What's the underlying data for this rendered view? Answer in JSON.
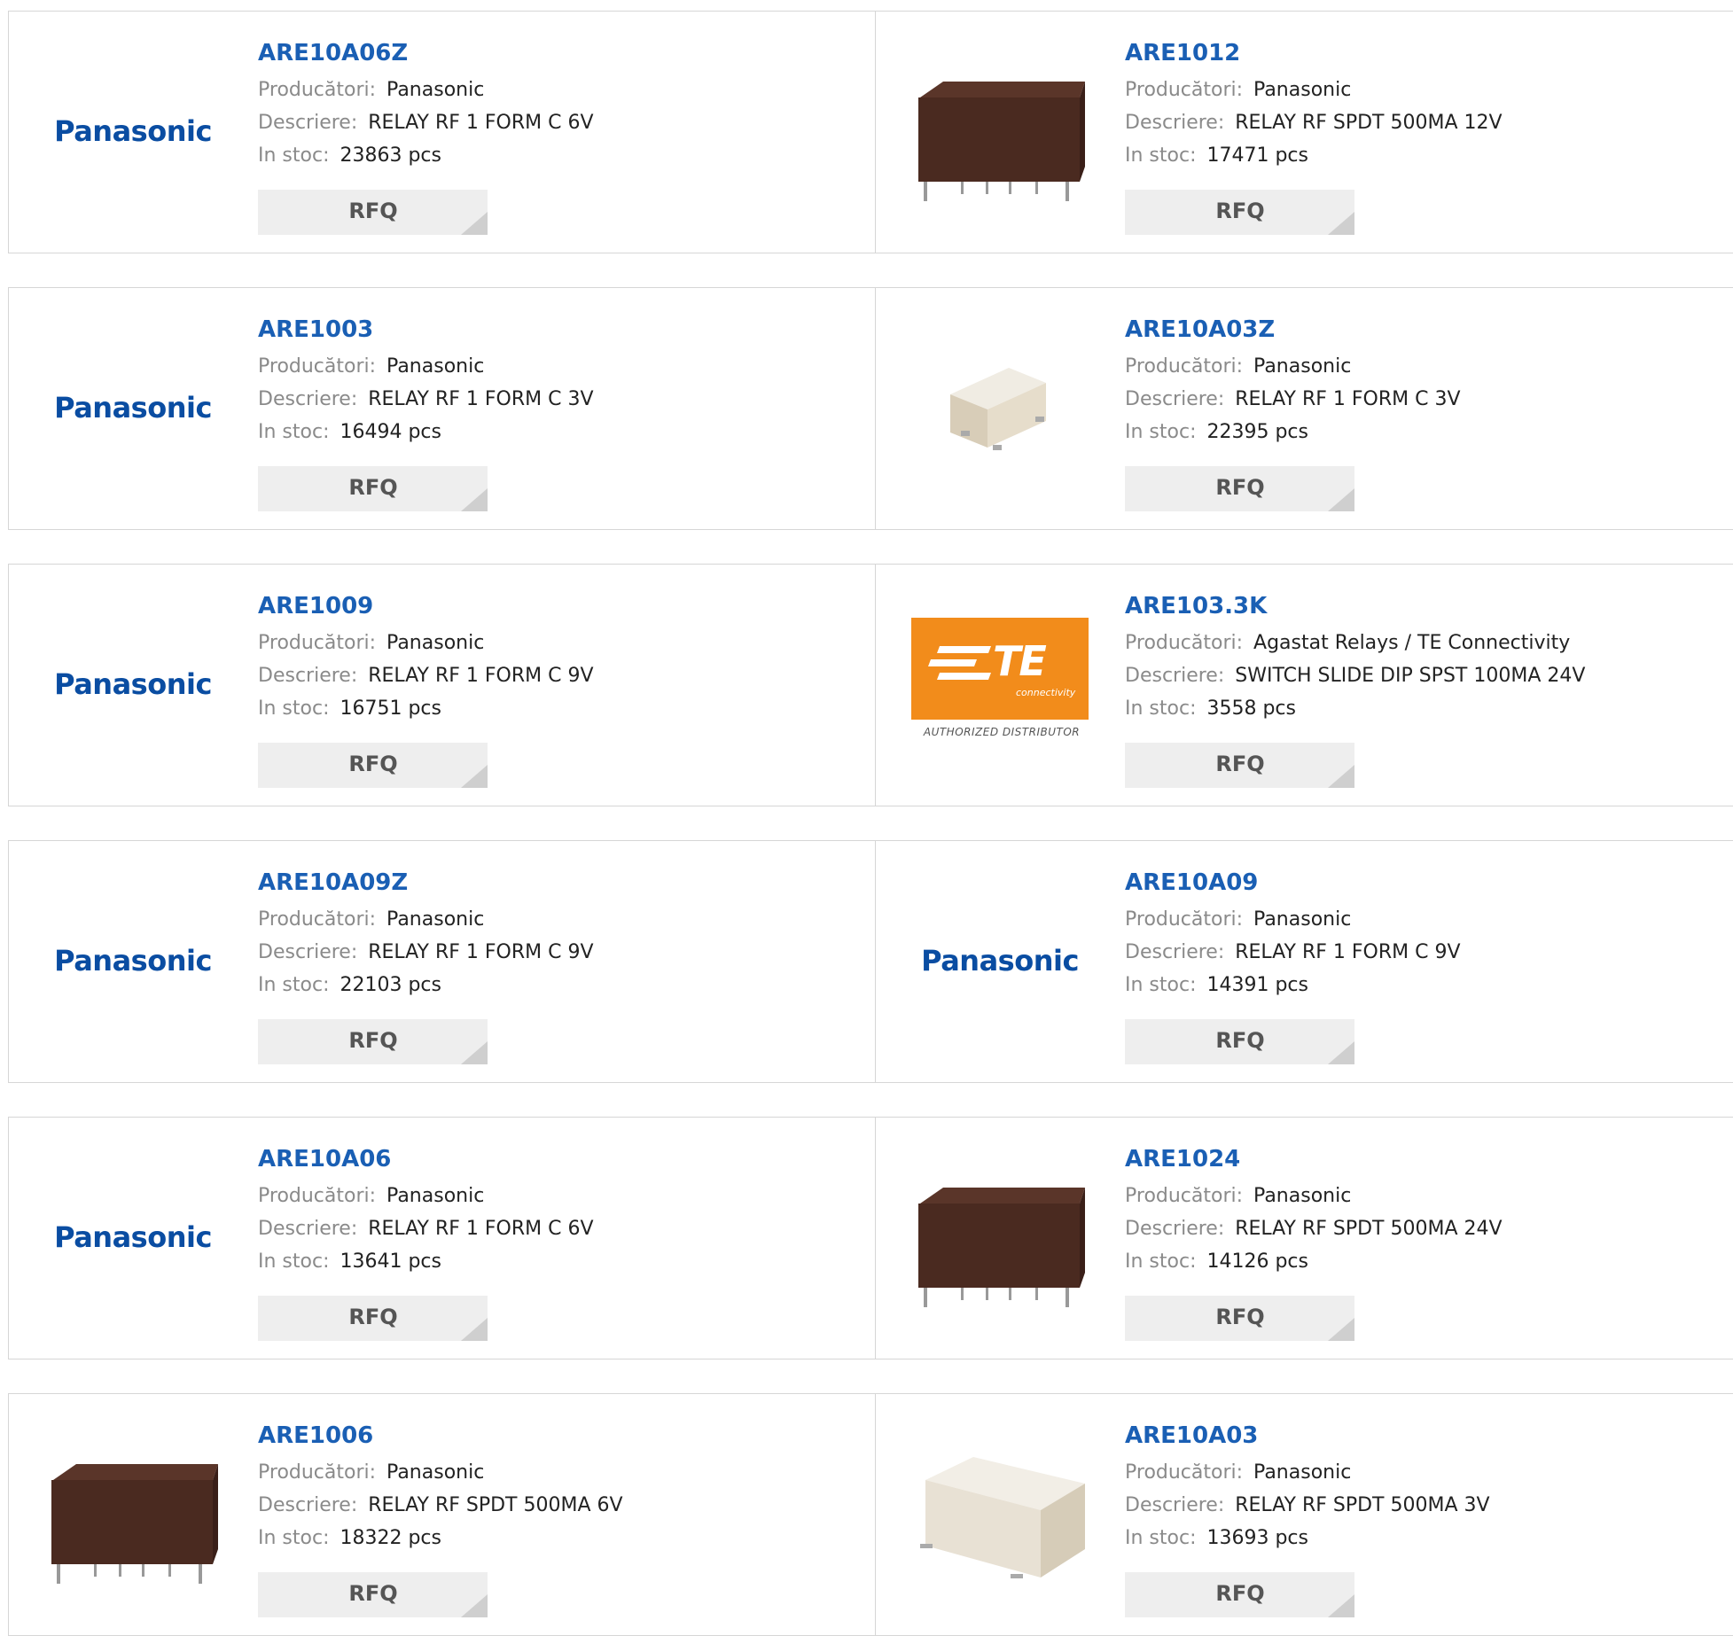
{
  "labels": {
    "manufacturer": "Producători:",
    "description": "Descriere:",
    "stock": "In stoc:",
    "rfq": "RFQ"
  },
  "brand_logos": {
    "panasonic": "Panasonic",
    "te_mark": "TE",
    "te_sub": "connectivity",
    "te_authorized": "AUTHORIZED DISTRIBUTOR"
  },
  "colors": {
    "part_link": "#1a5fb4",
    "panasonic_blue": "#0a4da2",
    "te_orange": "#f28c1b",
    "relay_brown": "#4a2a20",
    "relay_beige": "#ebe6dc"
  },
  "products": [
    {
      "part": "ARE10A06Z",
      "manufacturer": "Panasonic",
      "description": "RELAY RF 1 FORM C 6V",
      "stock": "23863 pcs",
      "image": "panasonic-logo"
    },
    {
      "part": "ARE1012",
      "manufacturer": "Panasonic",
      "description": "RELAY RF SPDT 500MA 12V",
      "stock": "17471 pcs",
      "image": "brown-relay-photo"
    },
    {
      "part": "ARE1003",
      "manufacturer": "Panasonic",
      "description": "RELAY RF 1 FORM C 3V",
      "stock": "16494 pcs",
      "image": "panasonic-logo"
    },
    {
      "part": "ARE10A03Z",
      "manufacturer": "Panasonic",
      "description": "RELAY RF 1 FORM C 3V",
      "stock": "22395 pcs",
      "image": "beige-smd-relay-photo"
    },
    {
      "part": "ARE1009",
      "manufacturer": "Panasonic",
      "description": "RELAY RF 1 FORM C 9V",
      "stock": "16751 pcs",
      "image": "panasonic-logo"
    },
    {
      "part": "ARE103.3K",
      "manufacturer": "Agastat Relays / TE Connectivity",
      "description": "SWITCH SLIDE DIP SPST 100MA 24V",
      "stock": "3558 pcs",
      "image": "te-logo"
    },
    {
      "part": "ARE10A09Z",
      "manufacturer": "Panasonic",
      "description": "RELAY RF 1 FORM C 9V",
      "stock": "22103 pcs",
      "image": "panasonic-logo"
    },
    {
      "part": "ARE10A09",
      "manufacturer": "Panasonic",
      "description": "RELAY RF 1 FORM C 9V",
      "stock": "14391 pcs",
      "image": "panasonic-logo"
    },
    {
      "part": "ARE10A06",
      "manufacturer": "Panasonic",
      "description": "RELAY RF 1 FORM C 6V",
      "stock": "13641 pcs",
      "image": "panasonic-logo"
    },
    {
      "part": "ARE1024",
      "manufacturer": "Panasonic",
      "description": "RELAY RF SPDT 500MA 24V",
      "stock": "14126 pcs",
      "image": "brown-relay-photo"
    },
    {
      "part": "ARE1006",
      "manufacturer": "Panasonic",
      "description": "RELAY RF SPDT 500MA 6V",
      "stock": "18322 pcs",
      "image": "brown-relay-photo"
    },
    {
      "part": "ARE10A03",
      "manufacturer": "Panasonic",
      "description": "RELAY RF SPDT 500MA 3V",
      "stock": "13693 pcs",
      "image": "beige-relay-photo"
    }
  ]
}
